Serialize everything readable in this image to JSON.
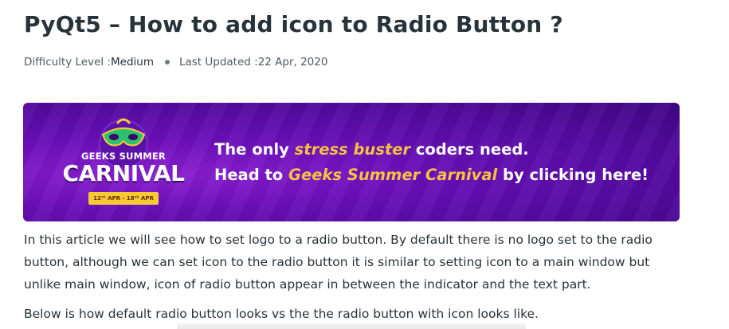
{
  "article": {
    "title": "PyQt5 – How to add icon to Radio Button ?",
    "difficulty_label": "Difficulty Level : ",
    "difficulty_value": "Medium",
    "updated_label": "Last Updated : ",
    "updated_value": "22 Apr, 2020"
  },
  "banner": {
    "logo_top": "GEEKS SUMMER",
    "logo_main": "CARNIVAL",
    "logo_dates": "12ᵗʰ APR - 18ᵗʰ APR",
    "line1_a": "The only ",
    "line1_hl": "stress buster",
    "line1_b": " coders need.",
    "line2_a": "Head to ",
    "line2_hl": "Geeks Summer Carnival",
    "line2_b": " by clicking here!",
    "colors": {
      "bg": "#6a0fb8",
      "highlight": "#f5c242"
    }
  },
  "content": {
    "paragraph1": "In this article we will see how to set logo to a radio button. By default there is no logo set to the radio button, although we can set icon to the radio button it is similar to setting icon to a main window but unlike main window, icon of radio button appear in between the indicator and the text part.",
    "paragraph2": "Below is how default radio button looks vs the the radio button with icon looks like."
  }
}
